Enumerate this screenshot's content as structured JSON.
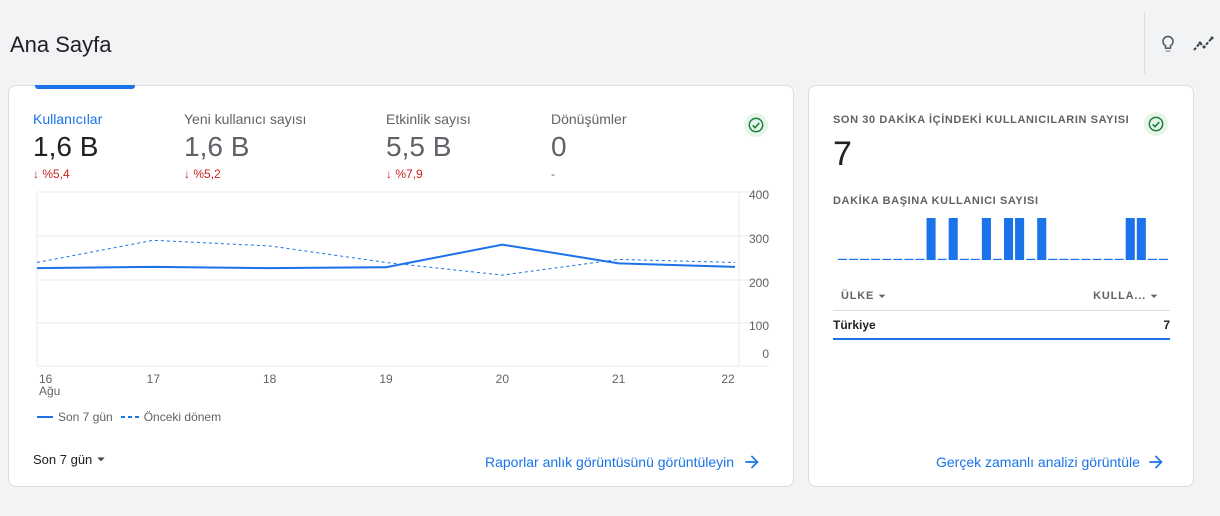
{
  "header": {
    "title": "Ana Sayfa"
  },
  "icons": {
    "insights": "lightbulb-icon",
    "trend": "trending-icon"
  },
  "colors": {
    "accent": "#1a73e8",
    "negative": "#c5221f",
    "success": "#188038"
  },
  "overview": {
    "metrics": [
      {
        "label": "Kullanıcılar",
        "value": "1,6 B",
        "delta": "%5,4",
        "direction": "down"
      },
      {
        "label": "Yeni kullanıcı sayısı",
        "value": "1,6 B",
        "delta": "%5,2",
        "direction": "down"
      },
      {
        "label": "Etkinlik sayısı",
        "value": "5,5 B",
        "delta": "%7,9",
        "direction": "down"
      },
      {
        "label": "Dönüşümler",
        "value": "0",
        "delta": "-",
        "direction": "none"
      }
    ],
    "period_selector": "Son 7 gün",
    "link": "Raporlar anlık görüntüsünü görüntüleyin"
  },
  "chart_data": {
    "type": "line",
    "categories": [
      "16 Ağu",
      "17",
      "18",
      "19",
      "20",
      "21",
      "22"
    ],
    "x_tick_labels": [
      "16",
      "17",
      "18",
      "19",
      "20",
      "21",
      "22"
    ],
    "x_tick_sublabel": "Ağu",
    "y_ticks": [
      "400",
      "300",
      "200",
      "100",
      "0"
    ],
    "ylim": [
      0,
      400
    ],
    "series": [
      {
        "name": "Son 7 gün",
        "style": "solid",
        "values": [
          225,
          228,
          225,
          227,
          279,
          236,
          228
        ]
      },
      {
        "name": "Önceki dönem",
        "style": "dashed",
        "values": [
          238,
          289,
          276,
          238,
          209,
          245,
          238
        ]
      }
    ],
    "grid": true,
    "legend_position": "bottom-left"
  },
  "realtime": {
    "title": "SON 30 DAKİKA İÇİNDEKİ KULLANICILARIN SAYISI",
    "count": "7",
    "per_minute_title": "DAKİKA BAŞINA KULLANICI SAYISI",
    "per_minute_values": [
      0,
      0,
      0,
      0,
      0,
      0,
      0,
      0,
      0,
      0,
      0,
      0,
      0,
      0,
      0,
      0,
      0,
      0,
      0,
      0,
      0,
      0,
      0,
      0,
      0,
      0,
      0,
      0,
      0,
      0
    ],
    "active_minutes": [
      8,
      10,
      13,
      15,
      16,
      18,
      26,
      27
    ],
    "table": {
      "col_country": "ÜLKE",
      "col_users": "KULLA...",
      "rows": [
        {
          "country": "Türkiye",
          "users": "7"
        }
      ]
    },
    "link": "Gerçek zamanlı analizi görüntüle"
  }
}
